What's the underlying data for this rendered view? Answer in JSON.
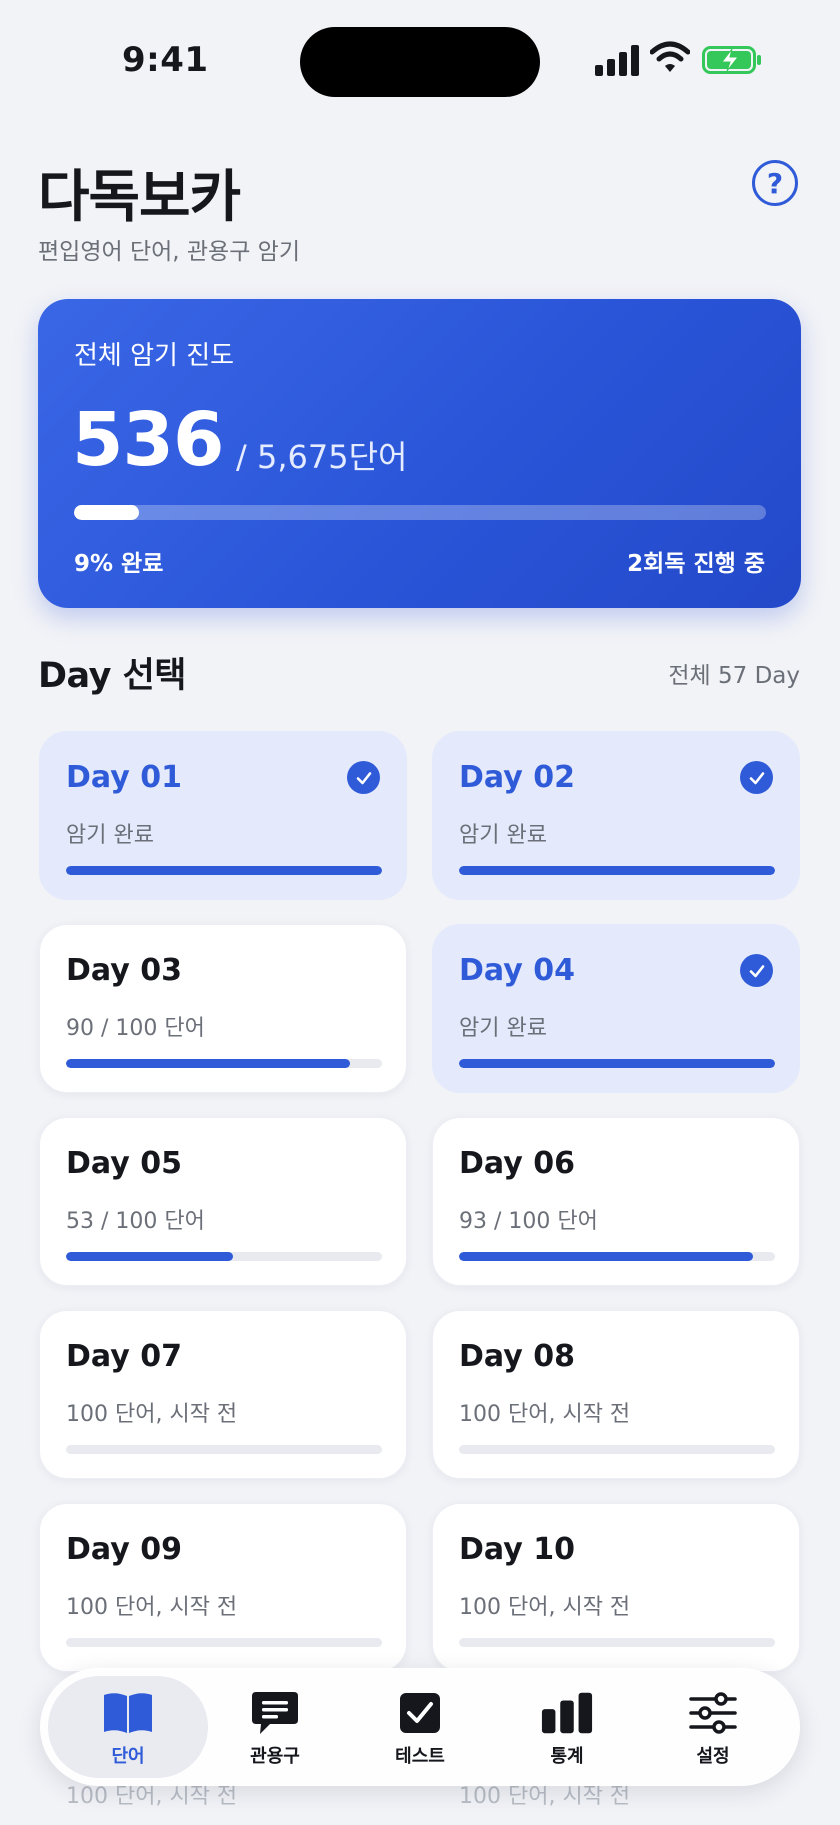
{
  "status_bar": {
    "time": "9:41"
  },
  "header": {
    "title": "다독보카",
    "subtitle": "편입영어 단어, 관용구 암기",
    "help_icon": "question-circle-icon",
    "help_glyph": "?"
  },
  "progress": {
    "label": "전체 암기 진도",
    "count": "536",
    "total": "/ 5,675단어",
    "fraction": 0.094,
    "percent_label": "9% 완료",
    "round_label": "2회독 진행 중"
  },
  "day_section": {
    "title": "Day 선택",
    "count": "전체 57 Day"
  },
  "days": [
    {
      "name": "Day 01",
      "status": "암기 완료",
      "done": true,
      "progress": 1.0
    },
    {
      "name": "Day 02",
      "status": "암기 완료",
      "done": true,
      "progress": 1.0
    },
    {
      "name": "Day 03",
      "status": "90 / 100 단어",
      "done": false,
      "progress": 0.9
    },
    {
      "name": "Day 04",
      "status": "암기 완료",
      "done": true,
      "progress": 1.0
    },
    {
      "name": "Day 05",
      "status": "53 / 100 단어",
      "done": false,
      "progress": 0.53
    },
    {
      "name": "Day 06",
      "status": "93 / 100 단어",
      "done": false,
      "progress": 0.93
    },
    {
      "name": "Day 07",
      "status": "100 단어, 시작 전",
      "done": false,
      "progress": 0
    },
    {
      "name": "Day 08",
      "status": "100 단어, 시작 전",
      "done": false,
      "progress": 0
    },
    {
      "name": "Day 09",
      "status": "100 단어, 시작 전",
      "done": false,
      "progress": 0
    },
    {
      "name": "Day 10",
      "status": "100 단어, 시작 전",
      "done": false,
      "progress": 0
    }
  ],
  "partial_row": {
    "left_status": "100 단어, 시작 전",
    "right_status": "100 단어, 시작 전"
  },
  "tabs": [
    {
      "label": "단어",
      "icon": "book-icon",
      "active": true
    },
    {
      "label": "관용구",
      "icon": "chat-bubble-icon",
      "active": false
    },
    {
      "label": "테스트",
      "icon": "checkbox-icon",
      "active": false
    },
    {
      "label": "통계",
      "icon": "bar-chart-icon",
      "active": false
    },
    {
      "label": "설정",
      "icon": "sliders-icon",
      "active": false
    }
  ],
  "colors": {
    "accent": "#2f5bd8",
    "background": "#f2f3f7",
    "battery": "#34c759"
  }
}
